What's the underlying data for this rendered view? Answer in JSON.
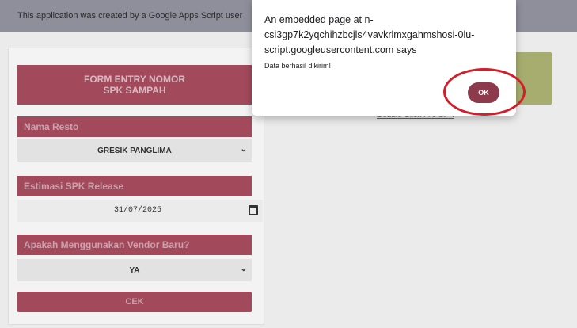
{
  "banner": {
    "text": "This application was created by a Google Apps Script user"
  },
  "form": {
    "header_line1": "FORM ENTRY NOMOR",
    "header_line2": "SPK SAMPAH",
    "fields": [
      {
        "label": "Nama Resto",
        "value": "GRESIK PANGLIMA"
      },
      {
        "label": "Estimasi SPK Release",
        "value": "31/07/2025"
      },
      {
        "label": "Apakah Menggunakan Vendor Baru?",
        "value": "YA"
      }
    ],
    "submit_label": "CEK"
  },
  "right_panel": {
    "link_text": "Double Click File SPK"
  },
  "dialog": {
    "title": "An embedded page at n-csi3gp7k2yqchihzbcjls4vavkrlmxgahmshosi-0lu-script.googleusercontent.com says",
    "message": "Data berhasil dikirim!",
    "ok_label": "OK"
  },
  "colors": {
    "accent": "#a24a5c",
    "ok_button": "#8c3a4c",
    "highlight": "#d11e2a",
    "right_card": "#a7ad6f"
  }
}
